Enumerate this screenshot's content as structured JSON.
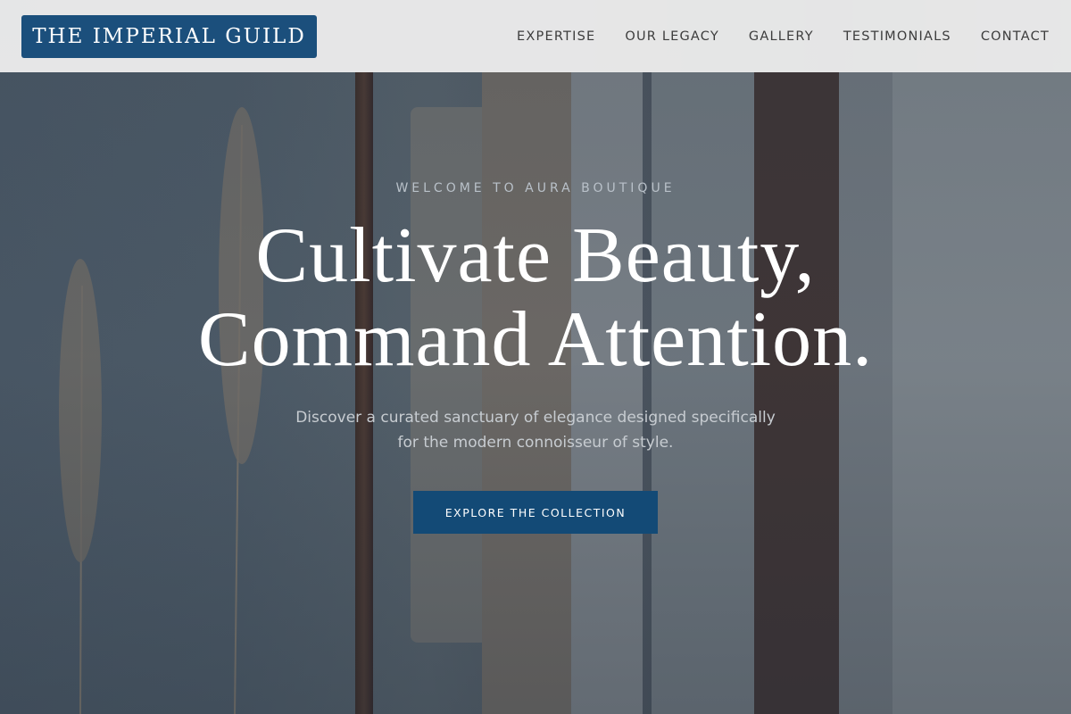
{
  "brand": {
    "name": "THE IMPERIAL GUILD",
    "color": "#1b4f7c"
  },
  "nav": {
    "items": [
      {
        "label": "EXPERTISE"
      },
      {
        "label": "OUR LEGACY"
      },
      {
        "label": "GALLERY"
      },
      {
        "label": "TESTIMONIALS"
      },
      {
        "label": "CONTACT"
      }
    ]
  },
  "hero": {
    "eyebrow": "WELCOME TO AURA BOUTIQUE",
    "headline_line1": "Cultivate Beauty,",
    "headline_line2": "Command Attention.",
    "subtitle_line1": "Discover a curated sanctuary of elegance designed specifically",
    "subtitle_line2": "for the modern connoisseur of style.",
    "cta_label": "EXPLORE THE COLLECTION",
    "cta_color": "#134a76",
    "background_image": "clothing-rack-with-pampas-grass"
  }
}
